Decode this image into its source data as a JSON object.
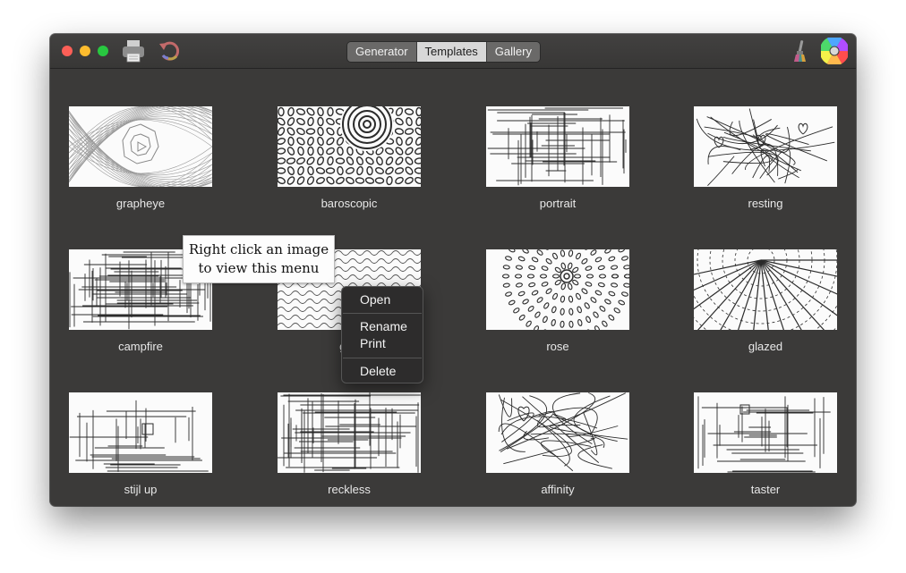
{
  "toolbar": {
    "tabs": [
      {
        "label": "Generator",
        "active": false
      },
      {
        "label": "Templates",
        "active": true
      },
      {
        "label": "Gallery",
        "active": false
      }
    ],
    "left_icons": [
      "print-icon",
      "undo-icon"
    ],
    "right_icons": [
      "brush-icon",
      "color-wheel-icon"
    ]
  },
  "gallery": {
    "items": [
      {
        "name": "grapheye",
        "pattern": "grapheye"
      },
      {
        "name": "baroscopic",
        "pattern": "baroscopic"
      },
      {
        "name": "portrait",
        "pattern": "portrait"
      },
      {
        "name": "resting",
        "pattern": "resting"
      },
      {
        "name": "campfire",
        "pattern": "campfire"
      },
      {
        "name": "ghost",
        "pattern": "ghost"
      },
      {
        "name": "rose",
        "pattern": "rose"
      },
      {
        "name": "glazed",
        "pattern": "glazed"
      },
      {
        "name": "stijl up",
        "pattern": "stijl"
      },
      {
        "name": "reckless",
        "pattern": "reckless"
      },
      {
        "name": "affinity",
        "pattern": "affinity"
      },
      {
        "name": "taster",
        "pattern": "taster"
      }
    ],
    "visible_captions": [
      "grapheye",
      "baroscopic",
      "portrait",
      "resting",
      "campfire",
      "gho",
      "rose",
      "glazed",
      "stijl up",
      "reckless",
      "affinity",
      "taster"
    ]
  },
  "tooltip": {
    "line1": "Right click an image",
    "line2": "to view this menu"
  },
  "context_menu": {
    "open": "Open",
    "rename": "Rename",
    "print": "Print",
    "delete": "Delete"
  },
  "colors": {
    "window_bg": "#3b3a39",
    "tab_active": "#d8d8d8",
    "tab_inactive": "#6a6968",
    "traffic_red": "#fc5f57",
    "traffic_yellow": "#fdbc2e",
    "traffic_green": "#28c840"
  }
}
